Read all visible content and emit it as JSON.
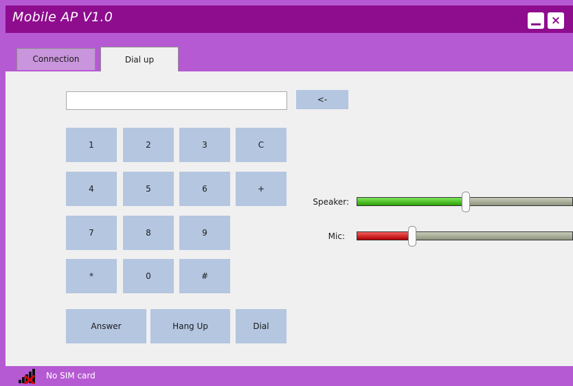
{
  "window": {
    "title": "Mobile AP V1.0",
    "minimize_icon": "minimize-icon",
    "close_glyph": "×"
  },
  "tabs": [
    {
      "label": "Connection",
      "selected": false
    },
    {
      "label": "Dial up",
      "selected": true
    }
  ],
  "dialer": {
    "number_value": "",
    "backspace_label": "<-",
    "keys": [
      "1",
      "2",
      "3",
      "C",
      "4",
      "5",
      "6",
      "+",
      "7",
      "8",
      "9",
      "*",
      "0",
      "#"
    ],
    "answer_label": "Answer",
    "hangup_label": "Hang Up",
    "dial_label": "Dial"
  },
  "audio": {
    "speaker": {
      "label": "Speaker:",
      "level": 0.505,
      "color": "#2c9f06"
    },
    "mic": {
      "label": "Mic:",
      "level": 0.255,
      "color": "#b00000"
    }
  },
  "status": {
    "icon": "no-signal-icon",
    "text": "No SIM card"
  },
  "colors": {
    "titlebar": "#8e0c8e",
    "chrome": "#b65ad3",
    "button": "#b4c6e0",
    "panel": "#f0f0f0"
  }
}
